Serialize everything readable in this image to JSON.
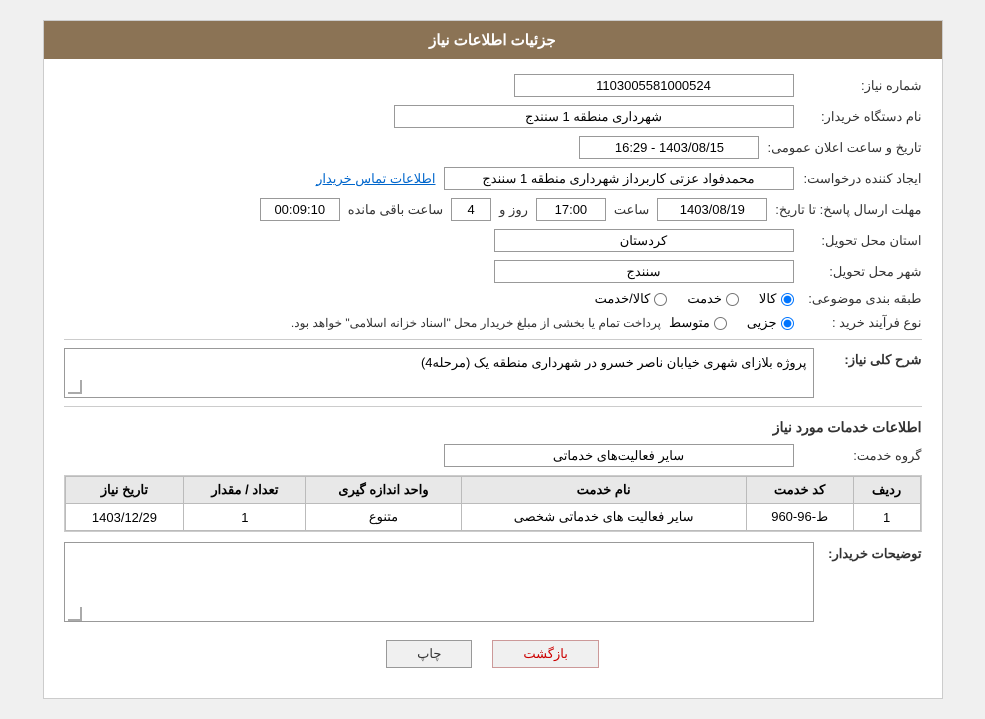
{
  "header": {
    "title": "جزئیات اطلاعات نیاز"
  },
  "fields": {
    "need_number_label": "شماره نیاز:",
    "need_number_value": "1103005581000524",
    "org_name_label": "نام دستگاه خریدار:",
    "org_name_value": "شهرداری منطقه 1 سنندج",
    "announce_label": "تاریخ و ساعت اعلان عمومی:",
    "announce_value": "1403/08/15 - 16:29",
    "creator_label": "ایجاد کننده درخواست:",
    "creator_value": "محمدفواد عزتی کاربرداز شهرداری منطقه 1 سنندج",
    "contact_link": "اطلاعات تماس خریدار",
    "deadline_label": "مهلت ارسال پاسخ: تا تاریخ:",
    "deadline_date": "1403/08/19",
    "deadline_time_label": "ساعت",
    "deadline_time": "17:00",
    "deadline_days_label": "روز و",
    "deadline_days": "4",
    "deadline_remaining_label": "ساعت باقی مانده",
    "deadline_remaining": "00:09:10",
    "province_label": "استان محل تحویل:",
    "province_value": "کردستان",
    "city_label": "شهر محل تحویل:",
    "city_value": "سنندج",
    "category_label": "طبقه بندی موضوعی:",
    "category_options": [
      "کالا",
      "خدمت",
      "کالا/خدمت"
    ],
    "category_selected": "کالا",
    "purchase_type_label": "نوع فرآیند خرید :",
    "purchase_type_options": [
      "جزیی",
      "متوسط"
    ],
    "purchase_type_note": "پرداخت تمام یا بخشی از مبلغ خریدار محل \"اسناد خزانه اسلامی\" خواهد بود.",
    "description_label": "شرح کلی نیاز:",
    "description_value": "پروژه بلازای شهری خیابان ناصر خسرو در شهرداری منطقه یک (مرحله4)",
    "services_section": "اطلاعات خدمات مورد نیاز",
    "service_group_label": "گروه خدمت:",
    "service_group_value": "سایر فعالیت‌های خدماتی",
    "table": {
      "headers": [
        "ردیف",
        "کد خدمت",
        "نام خدمت",
        "واحد اندازه گیری",
        "تعداد / مقدار",
        "تاریخ نیاز"
      ],
      "rows": [
        {
          "row": "1",
          "code": "ط-96-960",
          "name": "سایر فعالیت های خدماتی شخصی",
          "unit": "متنوع",
          "quantity": "1",
          "date": "1403/12/29"
        }
      ]
    },
    "buyer_notes_label": "توضیحات خریدار:",
    "buyer_notes_value": ""
  },
  "buttons": {
    "print_label": "چاپ",
    "back_label": "بازگشت"
  }
}
